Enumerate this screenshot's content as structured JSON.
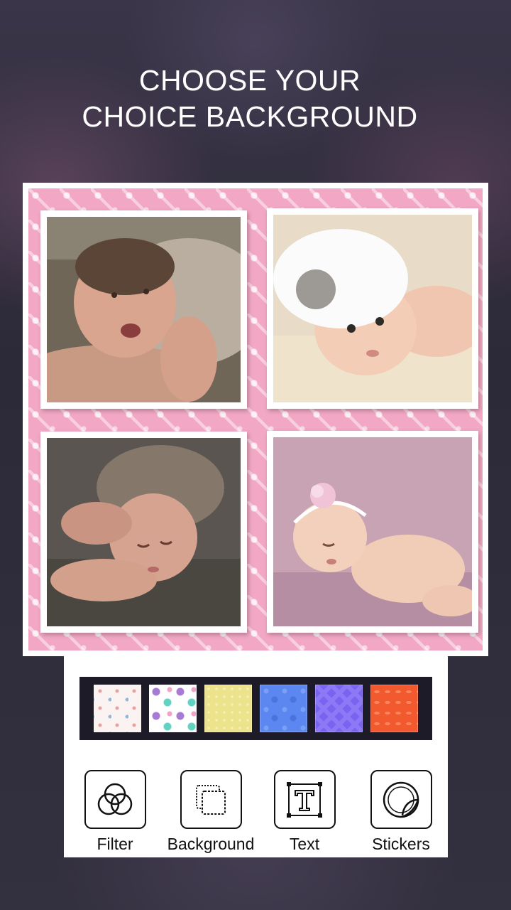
{
  "header": {
    "line1": "CHOOSE YOUR",
    "line2": "CHOICE BACKGROUND"
  },
  "collage": {
    "background_pattern": "pink-baby-pattern",
    "accent": "#f2a8c4",
    "photos": [
      {
        "subject": "baby-yawning-photo"
      },
      {
        "subject": "baby-white-hat-photo"
      },
      {
        "subject": "baby-knit-hat-photo"
      },
      {
        "subject": "baby-flower-headband-photo"
      }
    ]
  },
  "backgrounds": {
    "swatches": [
      {
        "name": "swatch-doodles",
        "color": "#faf3f1"
      },
      {
        "name": "swatch-flowers",
        "color": "#ffffff"
      },
      {
        "name": "swatch-yellow-dots",
        "color": "#ece38c"
      },
      {
        "name": "swatch-blue-bubbles",
        "color": "#5c86f0"
      },
      {
        "name": "swatch-purple-chevron",
        "color": "#7a63f0"
      },
      {
        "name": "swatch-orange-hearts",
        "color": "#f2592e"
      }
    ]
  },
  "toolbar": {
    "filter_label": "Filter",
    "background_label": "Background",
    "text_label": "Text",
    "stickers_label": "Stickers",
    "icons": [
      "filter-icon",
      "background-icon",
      "text-icon",
      "sticker-icon"
    ]
  }
}
